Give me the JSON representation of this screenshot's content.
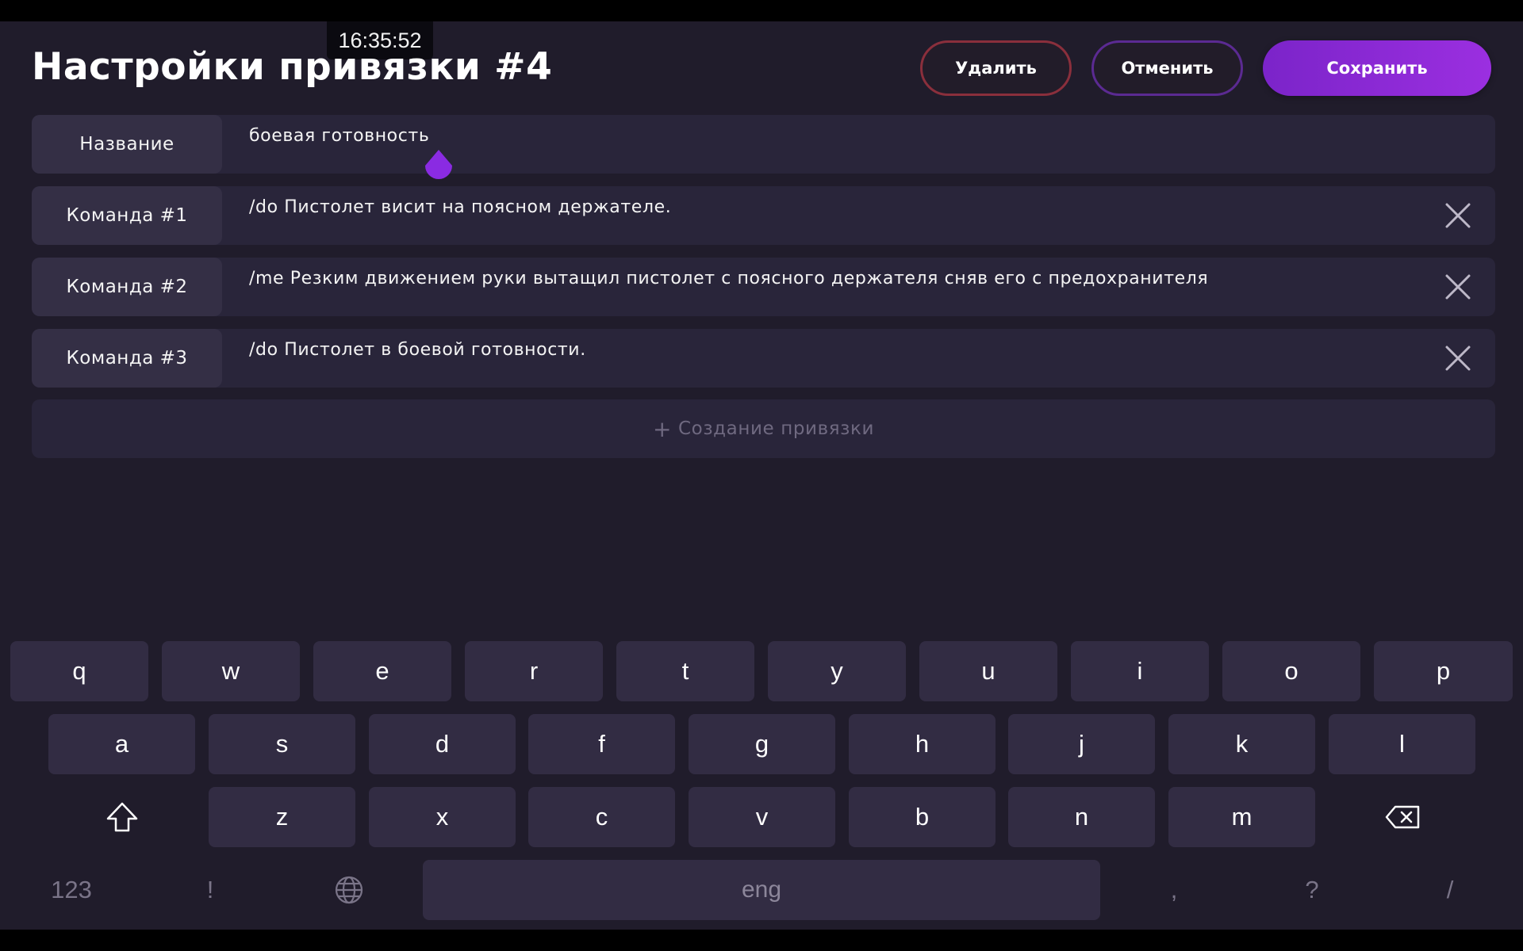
{
  "status": {
    "time": "16:35:52"
  },
  "header": {
    "title": "Настройки привязки #4",
    "delete_label": "Удалить",
    "cancel_label": "Отменить",
    "save_label": "Сохранить"
  },
  "fields": [
    {
      "label": "Название",
      "value": "боевая готовность",
      "removable": false
    },
    {
      "label": "Команда #1",
      "value": "/do Пистолет висит на поясном держателе.",
      "removable": true
    },
    {
      "label": "Команда #2",
      "value": "/me Резким движением руки вытащил пистолет с поясного держателя сняв его с предохранителя",
      "removable": true
    },
    {
      "label": "Команда #3",
      "value": "/do Пистолет в боевой готовности.",
      "removable": true
    }
  ],
  "add_binding_label": "Создание привязки",
  "keyboard": {
    "row1": [
      "q",
      "w",
      "e",
      "r",
      "t",
      "y",
      "u",
      "i",
      "o",
      "p"
    ],
    "row2": [
      "a",
      "s",
      "d",
      "f",
      "g",
      "h",
      "j",
      "k",
      "l"
    ],
    "row3": [
      "z",
      "x",
      "c",
      "v",
      "b",
      "n",
      "m"
    ],
    "bottom": {
      "numbers": "123",
      "exclaim": "!",
      "space": "eng",
      "comma": ",",
      "question": "?",
      "slash": "/"
    }
  },
  "colors": {
    "background": "#201c2b",
    "accent": "#8a2be2",
    "delete_border": "#8a2f3c",
    "cancel_border": "#5b2a92"
  },
  "icons": [
    "close-icon",
    "shift-icon",
    "backspace-icon",
    "globe-icon",
    "plus-icon",
    "text-cursor-handle-icon"
  ]
}
